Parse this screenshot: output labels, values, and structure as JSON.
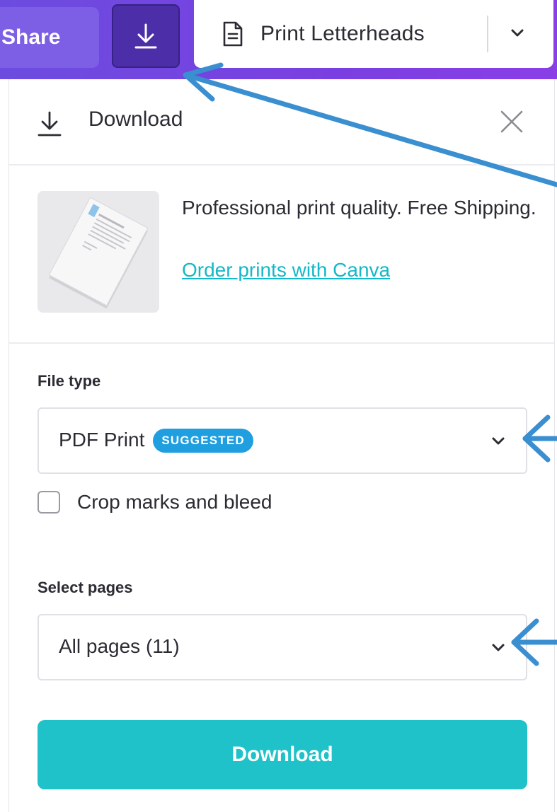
{
  "toolbar": {
    "share_label": "Share",
    "download_icon": "download-icon",
    "print_label": "Print Letterheads",
    "print_icon": "document-icon",
    "dropdown_icon": "chevron-down-icon"
  },
  "panel": {
    "title": "Download",
    "title_icon": "download-icon",
    "close_icon": "close-icon",
    "promo": {
      "text": "Professional print quality. Free Shipping.",
      "link": "Order prints with Canva"
    },
    "file_type": {
      "label": "File type",
      "value": "PDF Print",
      "badge": "SUGGESTED"
    },
    "crop_marks": {
      "label": "Crop marks and bleed",
      "checked": false
    },
    "select_pages": {
      "label": "Select pages",
      "value": "All pages (11)"
    },
    "download_button": "Download"
  },
  "colors": {
    "toolbar_purple": "#7a3fe0",
    "download_teal": "#1fc2c8",
    "link_teal": "#14b8c8",
    "badge_blue": "#1f9ee0",
    "annotation_arrow": "#3a8fd0"
  }
}
